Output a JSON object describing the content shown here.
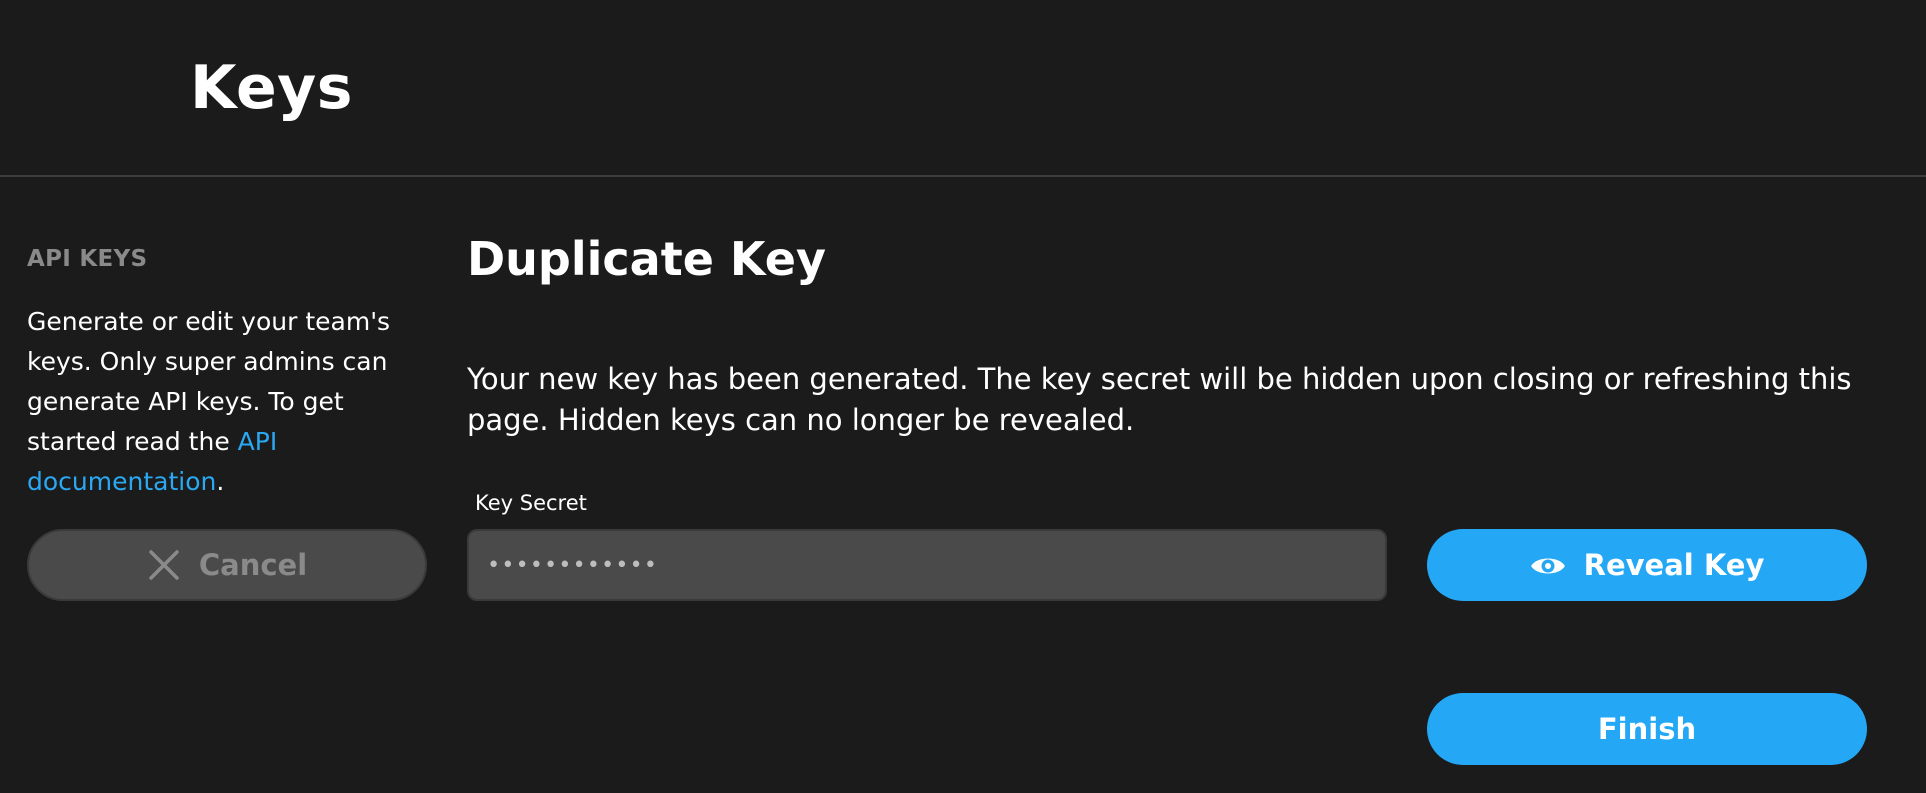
{
  "header": {
    "title": "Keys"
  },
  "sidebar": {
    "heading": "API KEYS",
    "description": "Generate or edit your team's keys. Only super admins can generate API keys. To get started read the ",
    "link_text": "API documentation",
    "link_suffix": ".",
    "cancel_label": "Cancel",
    "cancel_icon": "close-icon"
  },
  "main": {
    "title": "Duplicate Key",
    "description": "Your new key has been generated. The key secret will be hidden upon closing or refreshing this page. Hidden keys can no longer be revealed.",
    "key_secret_label": "Key Secret",
    "key_secret_value": "••••••••••••",
    "reveal_label": "Reveal Key",
    "reveal_icon": "eye-icon",
    "finish_label": "Finish"
  },
  "colors": {
    "background": "#1b1b1b",
    "accent": "#24a8f5",
    "link": "#2aa8f2",
    "muted": "#8a8a8a",
    "field": "#4a4a4a"
  }
}
